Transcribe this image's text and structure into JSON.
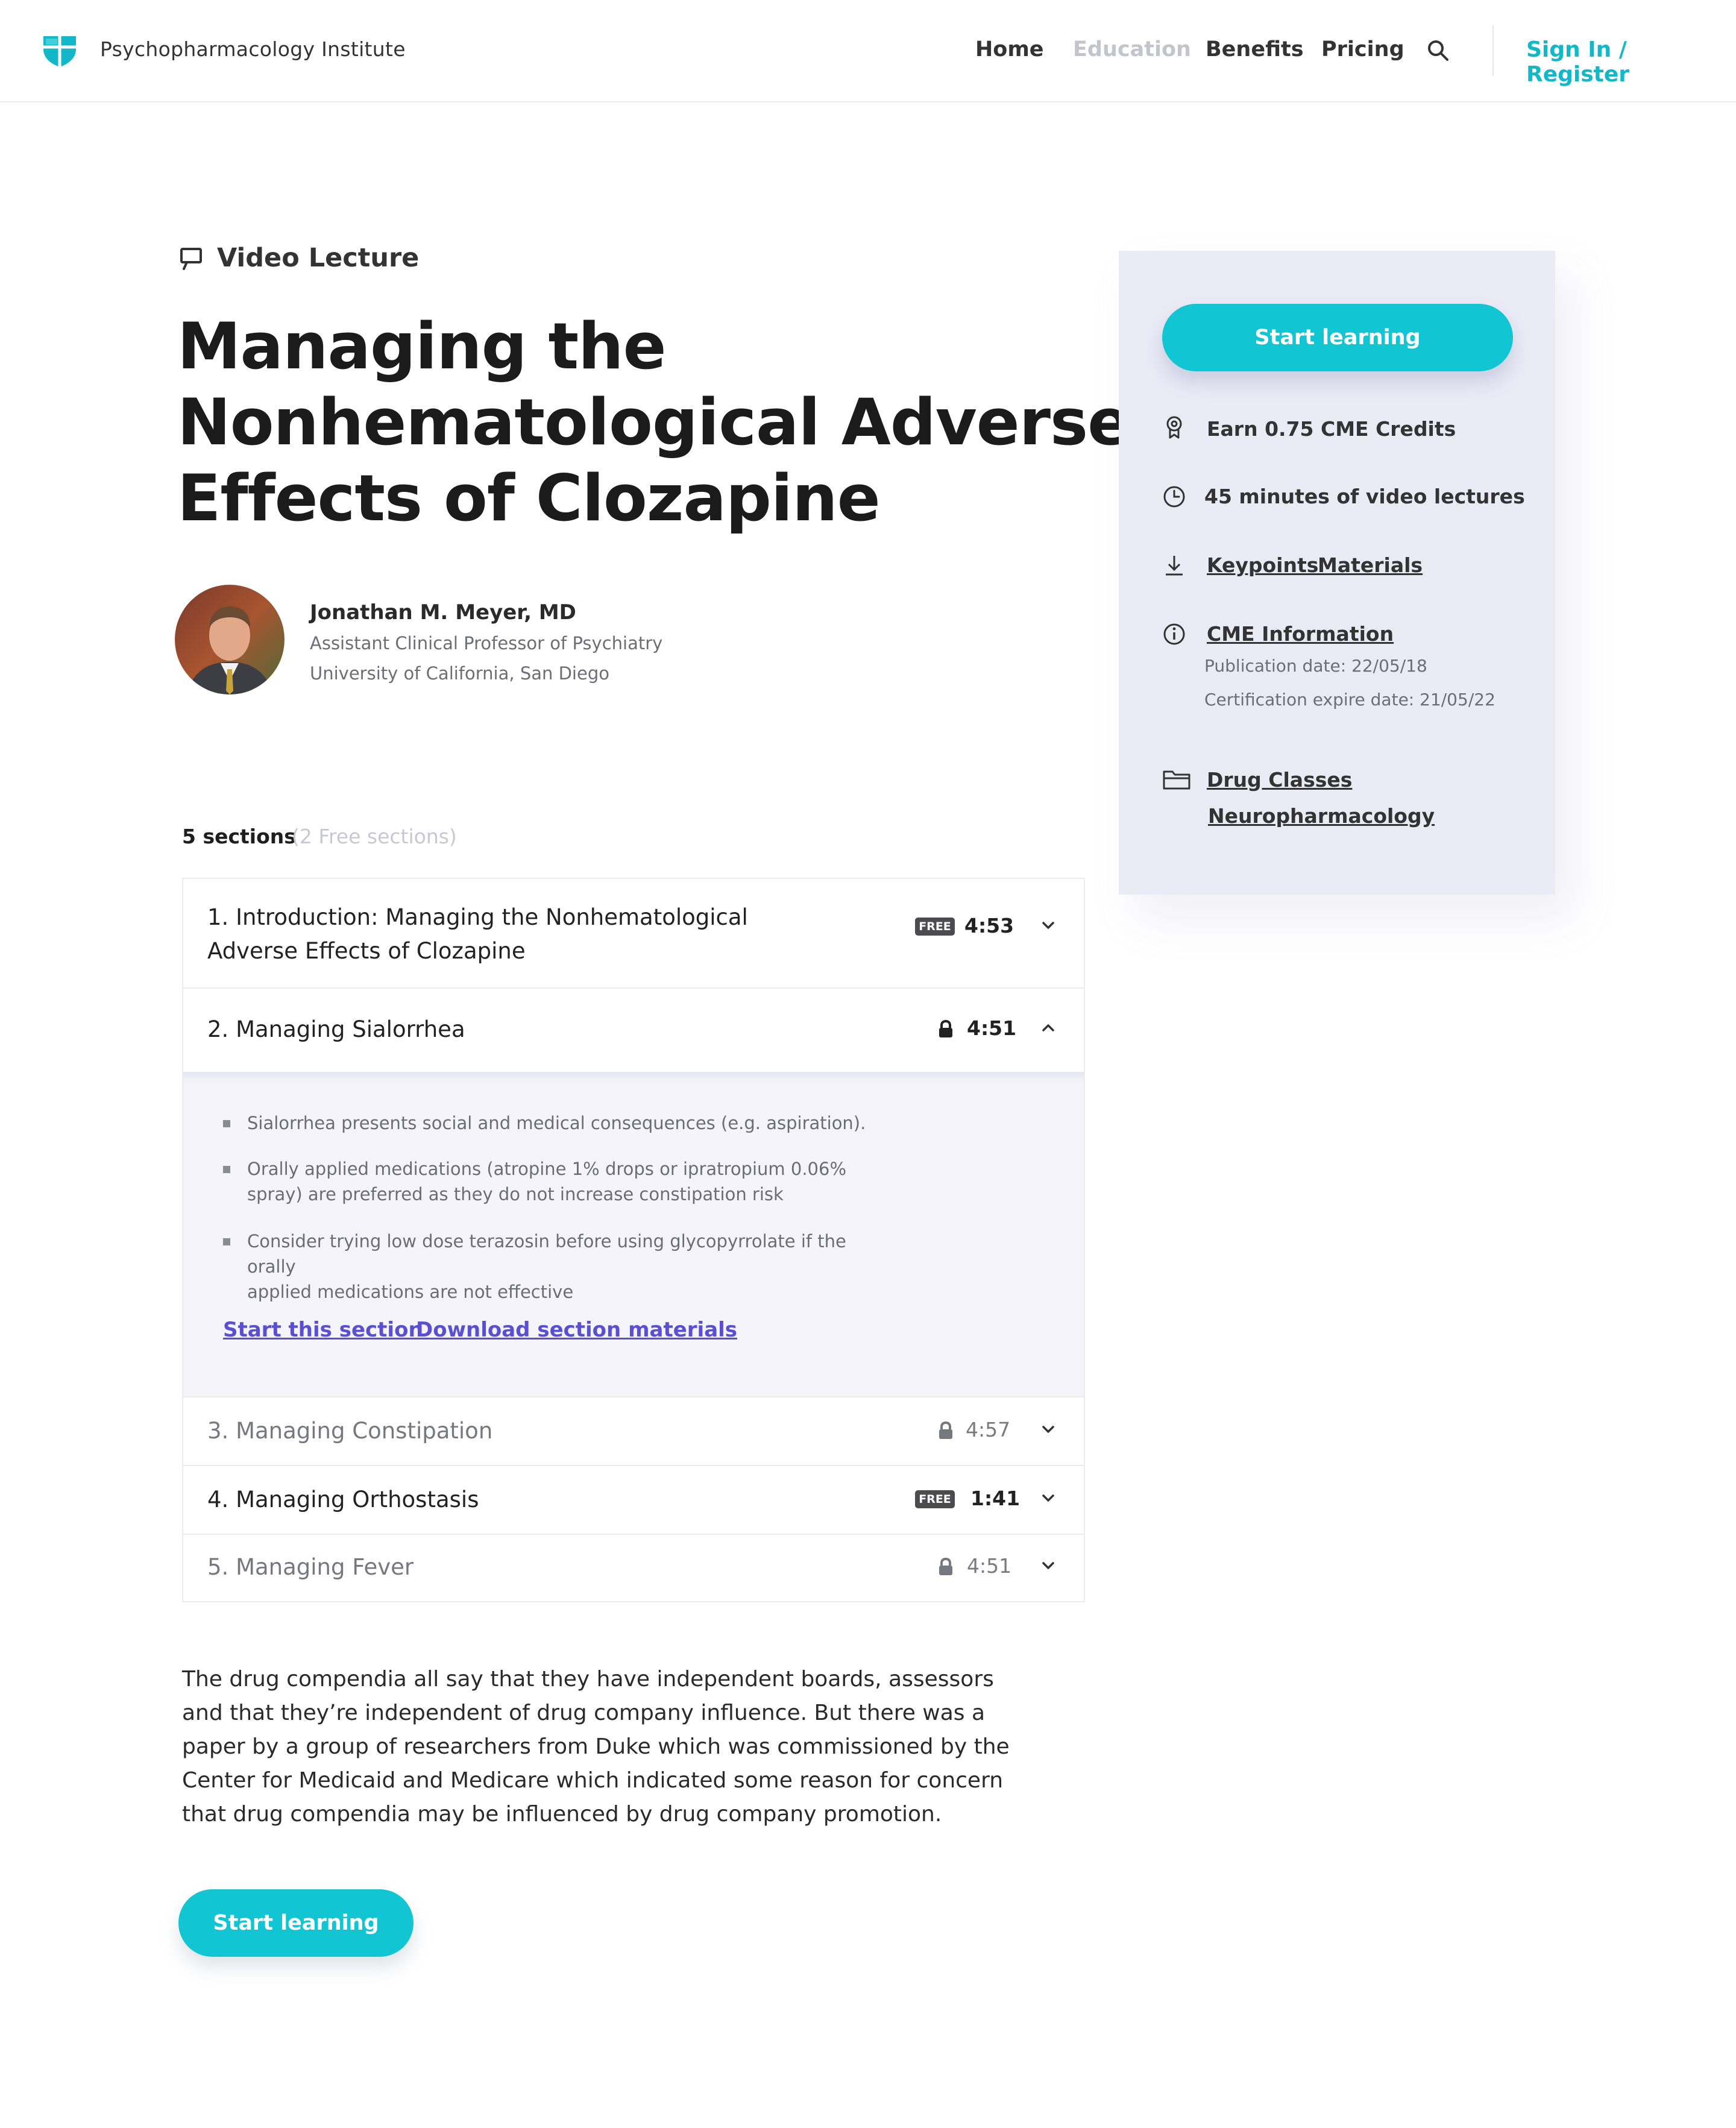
{
  "header": {
    "brand": "Psychopharmacology Institute",
    "nav": [
      {
        "label": "Home"
      },
      {
        "label": "Education"
      },
      {
        "label": "Benefits"
      },
      {
        "label": "Pricing"
      }
    ],
    "auth_label": "Sign In / Register",
    "accent_color": "#12b8c8"
  },
  "lecture": {
    "kind_label": "Video Lecture",
    "title_lines": [
      "Managing the",
      "Nonhematological Adverse",
      "Effects of Clozapine"
    ]
  },
  "author": {
    "name": "Jonathan M. Meyer, MD",
    "role": "Assistant Clinical Professor of Psychiatry",
    "institution": "University of California, San Diego"
  },
  "sections": {
    "count_label": "5 sections",
    "free_label": "(2 Free sections)",
    "items": [
      {
        "title_lines": [
          "1. Introduction: Managing the Nonhematological",
          "Adverse Effects of Clozapine"
        ],
        "badge": "FREE",
        "duration": "4:53"
      },
      {
        "title_lines": [
          "2. Managing Sialorrhea"
        ],
        "badge": "",
        "duration": "4:51",
        "keypoints": [
          [
            "Sialorrhea presents social and medical consequences (e.g. aspiration)."
          ],
          [
            "Orally applied medications (atropine 1% drops or ipratropium 0.06%",
            "spray) are preferred as they do not increase constipation risk"
          ],
          [
            "Consider trying low dose terazosin before using glycopyrrolate if the orally",
            "applied medications are not effective"
          ]
        ],
        "start_label": "Start this section",
        "download_label": "Download section materials"
      },
      {
        "title_lines": [
          "3. Managing Constipation"
        ],
        "badge": "",
        "duration": "4:57"
      },
      {
        "title_lines": [
          "4. Managing Orthostasis"
        ],
        "badge": "FREE",
        "duration": "1:41"
      },
      {
        "title_lines": [
          "5. Managing Fever"
        ],
        "badge": "",
        "duration": "4:51"
      }
    ]
  },
  "description_lines": [
    "The drug compendia all say that they have independent boards, assessors",
    "and that they’re independent of drug company influence. But there was a",
    "paper by a group of researchers from Duke which was commissioned by the",
    "Center for Medicaid and Medicare which indicated some reason for concern",
    "that drug compendia may be influenced by drug company promotion."
  ],
  "cta_label": "Start learning",
  "sidebar": {
    "cta_label": "Start learning",
    "credits": "Earn 0.75 CME Credits",
    "duration": "45 minutes of video lectures",
    "keypoints_link": "Keypoints",
    "materials_link": "Materials",
    "cme_link": "CME Information",
    "publication_date": "Publication date: 22/05/18",
    "expire_date": "Certification expire date: 21/05/22",
    "drug_classes_link": "Drug Classes",
    "neuro_link": "Neuropharmacology"
  },
  "icons": {
    "logo": "shield-logo-icon",
    "search": "search-icon",
    "kind": "presentation-icon",
    "lock": "lock-icon",
    "chevron_down": "chevron-down-icon",
    "chevron_up": "chevron-up-icon",
    "award": "award-icon",
    "clock": "clock-icon",
    "download": "download-icon",
    "info": "info-icon",
    "folder": "folder-icon"
  }
}
